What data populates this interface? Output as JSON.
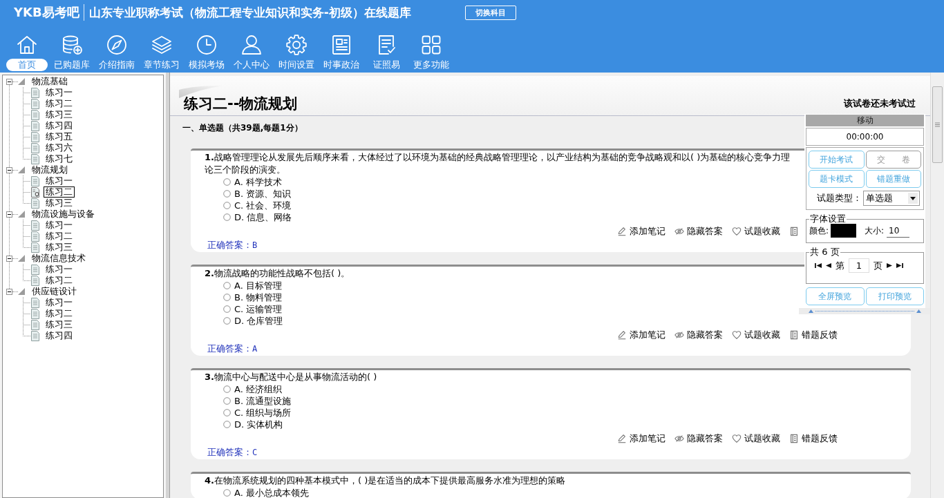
{
  "header": {
    "logo": "YKB易考吧",
    "title": "山东专业职称考试（物流工程专业知识和实务-初级）在线题库",
    "switch_button": "切换科目"
  },
  "toolbar": [
    {
      "label": "首页",
      "selected": true
    },
    {
      "label": "已购题库",
      "selected": false
    },
    {
      "label": "介绍指南",
      "selected": false
    },
    {
      "label": "章节练习",
      "selected": false
    },
    {
      "label": "模拟考场",
      "selected": false
    },
    {
      "label": "个人中心",
      "selected": false
    },
    {
      "label": "时间设置",
      "selected": false
    },
    {
      "label": "时事政治",
      "selected": false
    },
    {
      "label": "证照易",
      "selected": false
    },
    {
      "label": "更多功能",
      "selected": false
    }
  ],
  "tree": [
    {
      "label": "物流基础",
      "expanded": true,
      "children": [
        {
          "label": "练习一",
          "selected": false
        },
        {
          "label": "练习二",
          "selected": false
        },
        {
          "label": "练习三",
          "selected": false
        },
        {
          "label": "练习四",
          "selected": false
        },
        {
          "label": "练习五",
          "selected": false
        },
        {
          "label": "练习六",
          "selected": false
        },
        {
          "label": "练习七",
          "selected": false
        }
      ]
    },
    {
      "label": "物流规划",
      "expanded": true,
      "children": [
        {
          "label": "练习一",
          "selected": false
        },
        {
          "label": "练习二",
          "selected": true
        },
        {
          "label": "练习三",
          "selected": false
        }
      ]
    },
    {
      "label": "物流设施与设备",
      "expanded": true,
      "children": [
        {
          "label": "练习一",
          "selected": false
        },
        {
          "label": "练习二",
          "selected": false
        },
        {
          "label": "练习三",
          "selected": false
        }
      ]
    },
    {
      "label": "物流信息技术",
      "expanded": true,
      "children": [
        {
          "label": "练习一",
          "selected": false
        },
        {
          "label": "练习二",
          "selected": false
        }
      ]
    },
    {
      "label": "供应链设计",
      "expanded": true,
      "children": [
        {
          "label": "练习一",
          "selected": false
        },
        {
          "label": "练习二",
          "selected": false
        },
        {
          "label": "练习三",
          "selected": false
        },
        {
          "label": "练习四",
          "selected": false
        }
      ]
    }
  ],
  "exam": {
    "title": "练习二--物流规划",
    "status": "该试卷还未考试过",
    "section": "一、单选题（共39题,每题1分）"
  },
  "questions": [
    {
      "number": "1.",
      "text": "战略管理理论从发展先后顺序来看，大体经过了以环境为基础的经典战略管理理论，以产业结构为基础的竞争战略观和以( )为基础的核心竞争力理论三个阶段的演变。",
      "options": [
        {
          "text": "A. 科学技术",
          "selected": false
        },
        {
          "text": "B. 资源、知识",
          "selected": false
        },
        {
          "text": "C. 社会、环境",
          "selected": false
        },
        {
          "text": "D. 信息、网络",
          "selected": false
        }
      ],
      "actions": [
        {
          "kind": "note",
          "label": "添加笔记"
        },
        {
          "kind": "hide",
          "label": "隐藏答案"
        },
        {
          "kind": "favorite",
          "label": "试题收藏"
        },
        {
          "kind": "feedback"
        }
      ],
      "answer_label": "正确答案：",
      "answer": "B"
    },
    {
      "number": "2.",
      "text": "物流战略的功能性战略不包括( )。",
      "options": [
        {
          "text": "A. 目标管理",
          "selected": false
        },
        {
          "text": "B. 物料管理",
          "selected": false
        },
        {
          "text": "C. 运输管理",
          "selected": false
        },
        {
          "text": "D. 仓库管理",
          "selected": false
        }
      ],
      "actions": [
        {
          "kind": "note",
          "label": "添加笔记"
        },
        {
          "kind": "hide",
          "label": "隐藏答案"
        },
        {
          "kind": "favorite",
          "label": "试题收藏"
        },
        {
          "kind": "feedback",
          "label": "错题反馈"
        }
      ],
      "answer_label": "正确答案：",
      "answer": "A"
    },
    {
      "number": "3.",
      "text": "物流中心与配送中心是从事物流活动的( )",
      "options": [
        {
          "text": "A. 经济组织",
          "selected": false
        },
        {
          "text": "B. 流通型设施",
          "selected": false
        },
        {
          "text": "C. 组织与场所",
          "selected": false
        },
        {
          "text": "D. 实体机构",
          "selected": false
        }
      ],
      "actions": [
        {
          "kind": "note",
          "label": "添加笔记"
        },
        {
          "kind": "hide",
          "label": "隐藏答案"
        },
        {
          "kind": "favorite",
          "label": "试题收藏"
        },
        {
          "kind": "feedback",
          "label": "错题反馈"
        }
      ],
      "answer_label": "正确答案：",
      "answer": "C"
    },
    {
      "number": "4.",
      "text": "在物流系统规划的四种基本模式中，( )是在适当的成本下提供最高服务水准为理想的策略",
      "options": [
        {
          "text": "A. 最小总成本领先",
          "selected": false
        }
      ]
    }
  ],
  "panel": {
    "handle": "移动",
    "timer": "00:00:00",
    "buttons": [
      {
        "label": "开始考试",
        "disabled": false
      },
      {
        "label": "交　　卷",
        "disabled": true
      },
      {
        "label": "题卡模式",
        "disabled": false
      },
      {
        "label": "错题重做",
        "disabled": false
      }
    ],
    "type_label": "试题类型：",
    "type_value": "单选题",
    "font_legend": "字体设置",
    "color_label": "颜色:",
    "size_label": "大小:",
    "size_value": "10",
    "pages_legend": "共 6 页",
    "page_prefix": "第",
    "page_value": "1",
    "page_suffix": "页",
    "preview_buttons": [
      "全屏预览",
      "打印预览"
    ]
  }
}
